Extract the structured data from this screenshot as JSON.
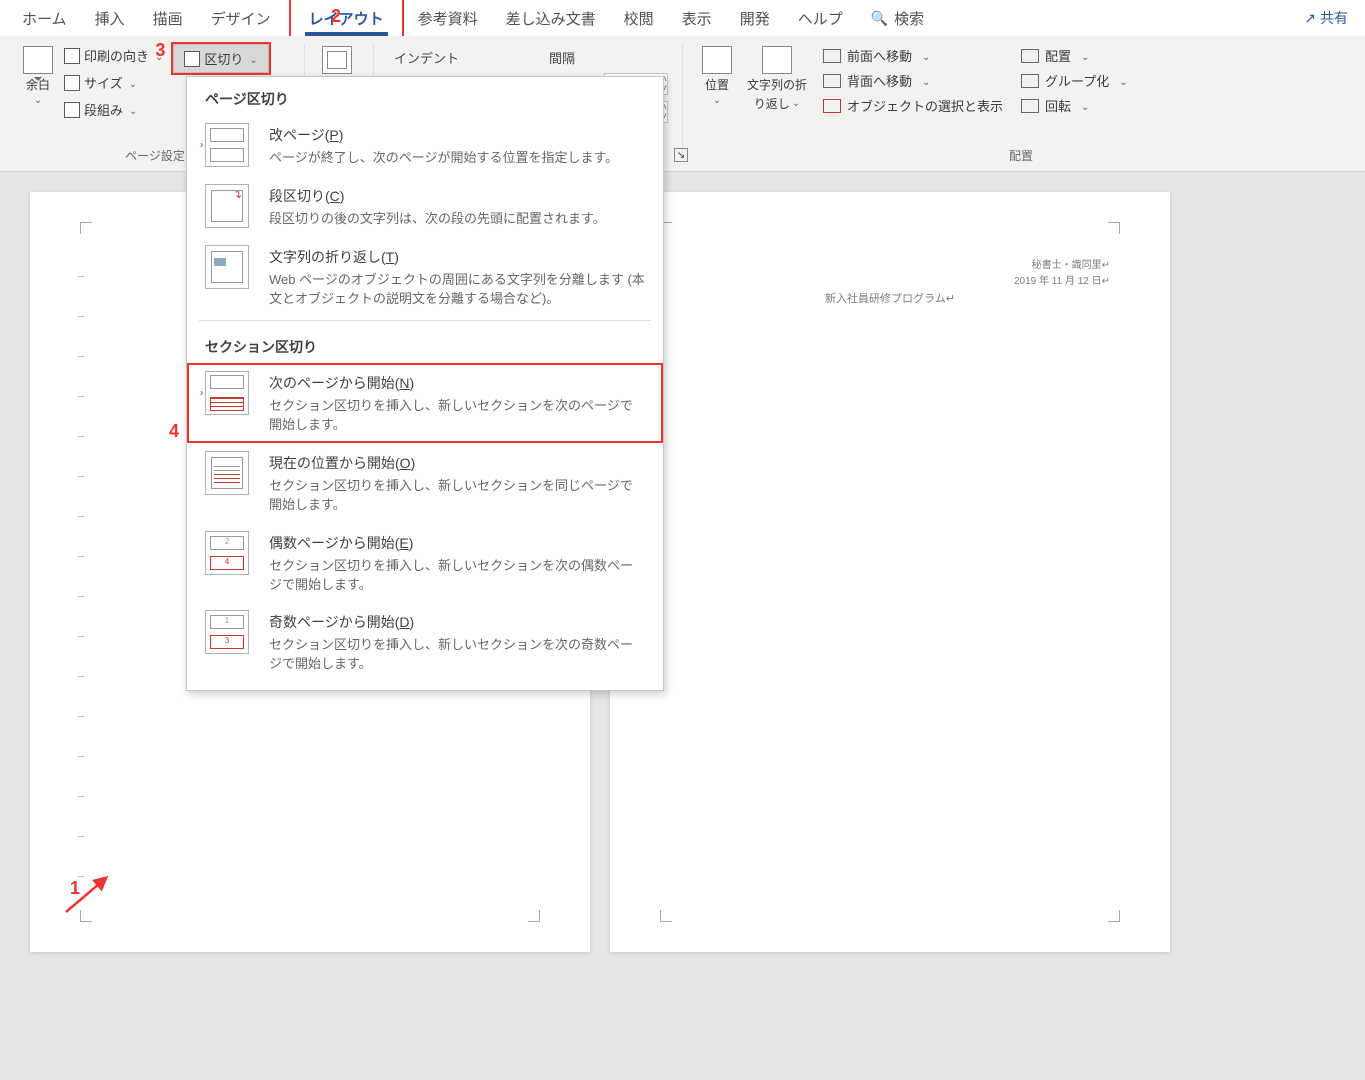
{
  "tabs": {
    "home": "ホーム",
    "insert": "挿入",
    "draw": "描画",
    "design": "デザイン",
    "layout": "レイアウト",
    "references": "参考資料",
    "mailings": "差し込み文書",
    "review": "校閲",
    "view": "表示",
    "developer": "開発",
    "help": "ヘルプ",
    "search": "検索",
    "share": "共有"
  },
  "ribbon": {
    "margins": "余白",
    "orientation": "印刷の向き",
    "size": "サイズ",
    "columns": "段組み",
    "breaks": "区切り",
    "group_pagesetup": "ページ設定",
    "indent_label": "インデント",
    "spacing_label": "間隔",
    "position": "位置",
    "wrap_text_1": "文字列の折",
    "wrap_text_2": "り返し",
    "bring_forward": "前面へ移動",
    "send_backward": "背面へ移動",
    "selection_pane": "オブジェクトの選択と表示",
    "align": "配置",
    "group": "グループ化",
    "rotate": "回転",
    "group_arrange": "配置"
  },
  "dropdown": {
    "section1": "ページ区切り",
    "page_break": {
      "title_pre": "改ページ(",
      "key": "P",
      "title_post": ")",
      "desc": "ページが終了し、次のページが開始する位置を指定します。"
    },
    "column_break": {
      "title_pre": "段区切り(",
      "key": "C",
      "title_post": ")",
      "desc": "段区切りの後の文字列は、次の段の先頭に配置されます。"
    },
    "text_wrap": {
      "title_pre": "文字列の折り返し(",
      "key": "T",
      "title_post": ")",
      "desc": "Web ページのオブジェクトの周囲にある文字列を分離します (本文とオブジェクトの説明文を分離する場合など)。"
    },
    "section2": "セクション区切り",
    "next_page": {
      "title_pre": "次のページから開始(",
      "key": "N",
      "title_post": ")",
      "desc": "セクション区切りを挿入し、新しいセクションを次のページで開始します。"
    },
    "continuous": {
      "title_pre": "現在の位置から開始(",
      "key": "O",
      "title_post": ")",
      "desc": "セクション区切りを挿入し、新しいセクションを同じページで開始します。"
    },
    "even_page": {
      "title_pre": "偶数ページから開始(",
      "key": "E",
      "title_post": ")",
      "desc": "セクション区切りを挿入し、新しいセクションを次の偶数ページで開始します。"
    },
    "odd_page": {
      "title_pre": "奇数ページから開始(",
      "key": "D",
      "title_post": ")",
      "desc": "セクション区切りを挿入し、新しいセクションを次の奇数ページで開始します。"
    }
  },
  "doc": {
    "header_line1": "秘書士・識同里↵",
    "header_line2": "2019 年 11 月 12 日↵",
    "body_line": "新入社員研修プログラム↵"
  },
  "annotations": {
    "n1": "1",
    "n2": "2",
    "n3": "3",
    "n4": "4"
  }
}
